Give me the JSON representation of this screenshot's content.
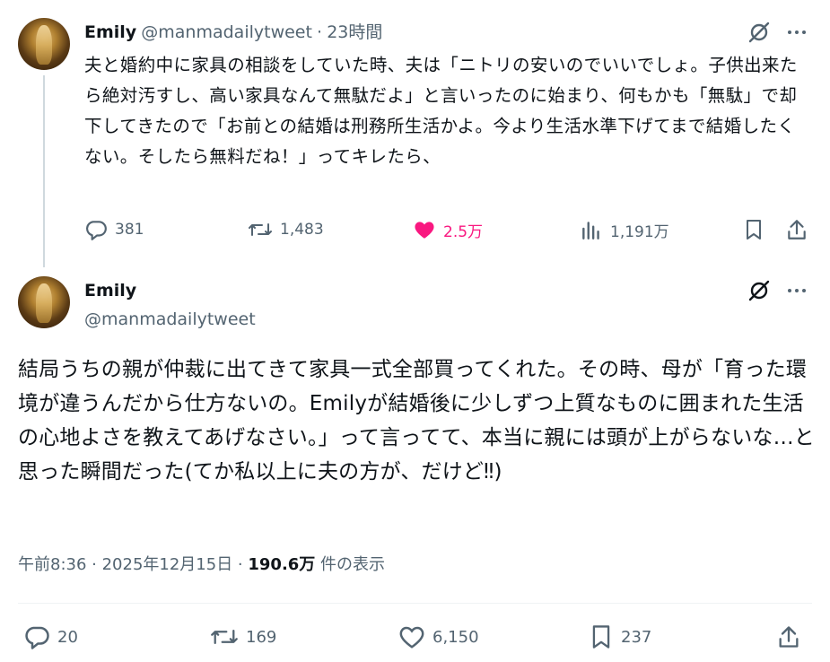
{
  "tweet1": {
    "author_name": "Emily",
    "handle": "@manmadailytweet",
    "separator": "·",
    "time": "23時間",
    "text": "夫と婚約中に家具の相談をしていた時、夫は「ニトリの安いのでいいでしょ。子供出来たら絶対汚すし、高い家具なんて無駄だよ」と言いったのに始まり、何もかも「無駄」で却下してきたので「お前との結婚は刑務所生活かよ。今より生活水準下げてまで結婚したくない。そしたら無料だね！」ってキレたら、",
    "actions": {
      "replies": "381",
      "retweets": "1,483",
      "likes": "2.5万",
      "views": "1,191万"
    },
    "liked": true
  },
  "tweet2": {
    "author_name": "Emily",
    "handle": "@manmadailytweet",
    "text": "結局うちの親が仲裁に出てきて家具一式全部買ってくれた。その時、母が「育った環境が違うんだから仕方ないの。Emilyが結婚後に少しずつ上質なものに囲まれた生活の心地よさを教えてあげなさい。」って言ってて、本当に親には頭が上がらないな…と思った瞬間だった(てか私以上に夫の方が、だけど‼)",
    "timestamp": "午前8:36 · 2025年12月15日 · ",
    "views_count": "190.6万",
    "views_label": " 件の表示",
    "actions": {
      "replies": "20",
      "retweets": "169",
      "likes": "6,150",
      "bookmarks": "237"
    }
  },
  "colors": {
    "text": "#0f1419",
    "secondary": "#536471",
    "like": "#f91880",
    "thread_line": "#cfd9de"
  },
  "icons": [
    "grok-icon",
    "more-icon",
    "reply-icon",
    "retweet-icon",
    "like-icon",
    "views-icon",
    "bookmark-icon",
    "share-icon"
  ]
}
